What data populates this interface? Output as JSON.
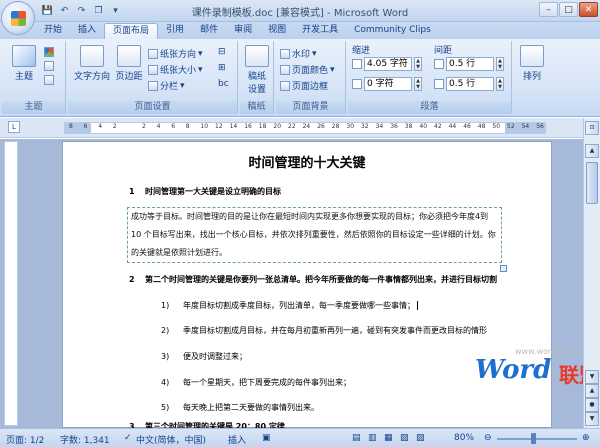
{
  "window": {
    "title": "课件录制模板.doc [兼容模式] - Microsoft Word",
    "min": "–",
    "max": "□",
    "close": "✕"
  },
  "qat": [
    "W",
    "💾",
    "↶",
    "↷",
    "❐",
    "▾"
  ],
  "tabs": [
    "开始",
    "插入",
    "页面布局",
    "引用",
    "邮件",
    "审阅",
    "视图",
    "开发工具",
    "Community Clips"
  ],
  "active_tab": 2,
  "ribbon": {
    "groups": [
      "主题",
      "页面设置",
      "稿纸",
      "页面背景",
      "段落"
    ],
    "theme": {
      "btn": "主题",
      "corner": "⌐"
    },
    "page_setup": {
      "text_direction": "文字方向",
      "margins": "页边距",
      "size_label": "纸张方向",
      "paper_size": "纸张大小",
      "columns": "分栏",
      "breaks": "⊟",
      "line_numbers": "⊞",
      "hyphen": "bc"
    },
    "manuscript": {
      "btn1": "稿纸",
      "btn2": "设置"
    },
    "background": {
      "watermark": "水印",
      "page_color": "页面颜色",
      "page_border": "页面边框"
    },
    "paragraph": {
      "indent_label": "缩进",
      "spacing_label": "间距",
      "indent_left": "4.05 字符",
      "indent_right": "0 字符",
      "spacing_before": "0.5 行",
      "spacing_after": "0.5 行"
    },
    "arrange": {
      "btn": "排列"
    }
  },
  "ruler": {
    "numbers": [
      "8",
      "6",
      "4",
      "2",
      "",
      "2",
      "4",
      "6",
      "8",
      "10",
      "12",
      "14",
      "16",
      "18",
      "20",
      "22",
      "24",
      "26",
      "28",
      "30",
      "32",
      "34",
      "36",
      "38",
      "40",
      "42",
      "44",
      "46",
      "48",
      "50",
      "",
      "54",
      "56"
    ],
    "highlight": [
      "52"
    ]
  },
  "document": {
    "title": "时间管理的十大关键",
    "h1": {
      "n": "1",
      "text": "时间管理第一大关键是设立明确的目标"
    },
    "para": "成功等于目标。时间管理的目的是让你在最短时间内实现更多你想要实现的目标；你必须把今年度4到 10 个目标写出来，找出一个核心目标，并依次排列重要性，然后依照你的目标设定一些详细的计划。你的关键就是依照计划进行。",
    "h2": {
      "n": "2",
      "text": "第二个时间管理的关键是你要列一张总清单。把今年所要做的每一件事情都列出来，并进行目标切割"
    },
    "items": [
      {
        "n": "1)",
        "text": "年度目标切割成季度目标，列出清单，每一季度要做哪一些事情；"
      },
      {
        "n": "2)",
        "text": "季度目标切割成月目标，并在每月初重新再列一遍，碰到有突发事件而更改目标的情形"
      },
      {
        "n": "3)",
        "text": "便及时调整过来；"
      },
      {
        "n": "4)",
        "text": "每一个星期天，把下周要完成的每件事列出来；"
      },
      {
        "n": "5)",
        "text": "每天晚上把第二天要做的事情列出来。"
      }
    ],
    "h3": {
      "n": "3",
      "text": "第三个时间管理的关键是 20：80 定律"
    }
  },
  "watermark": {
    "url": "www.wordlm.com",
    "word": "Word",
    "cn": "联盟"
  },
  "status": {
    "page": "页面: 1/2",
    "words": "字数: 1,341",
    "lang": "中文(简体，中国)",
    "mode": "插入",
    "zoom": "80%"
  }
}
